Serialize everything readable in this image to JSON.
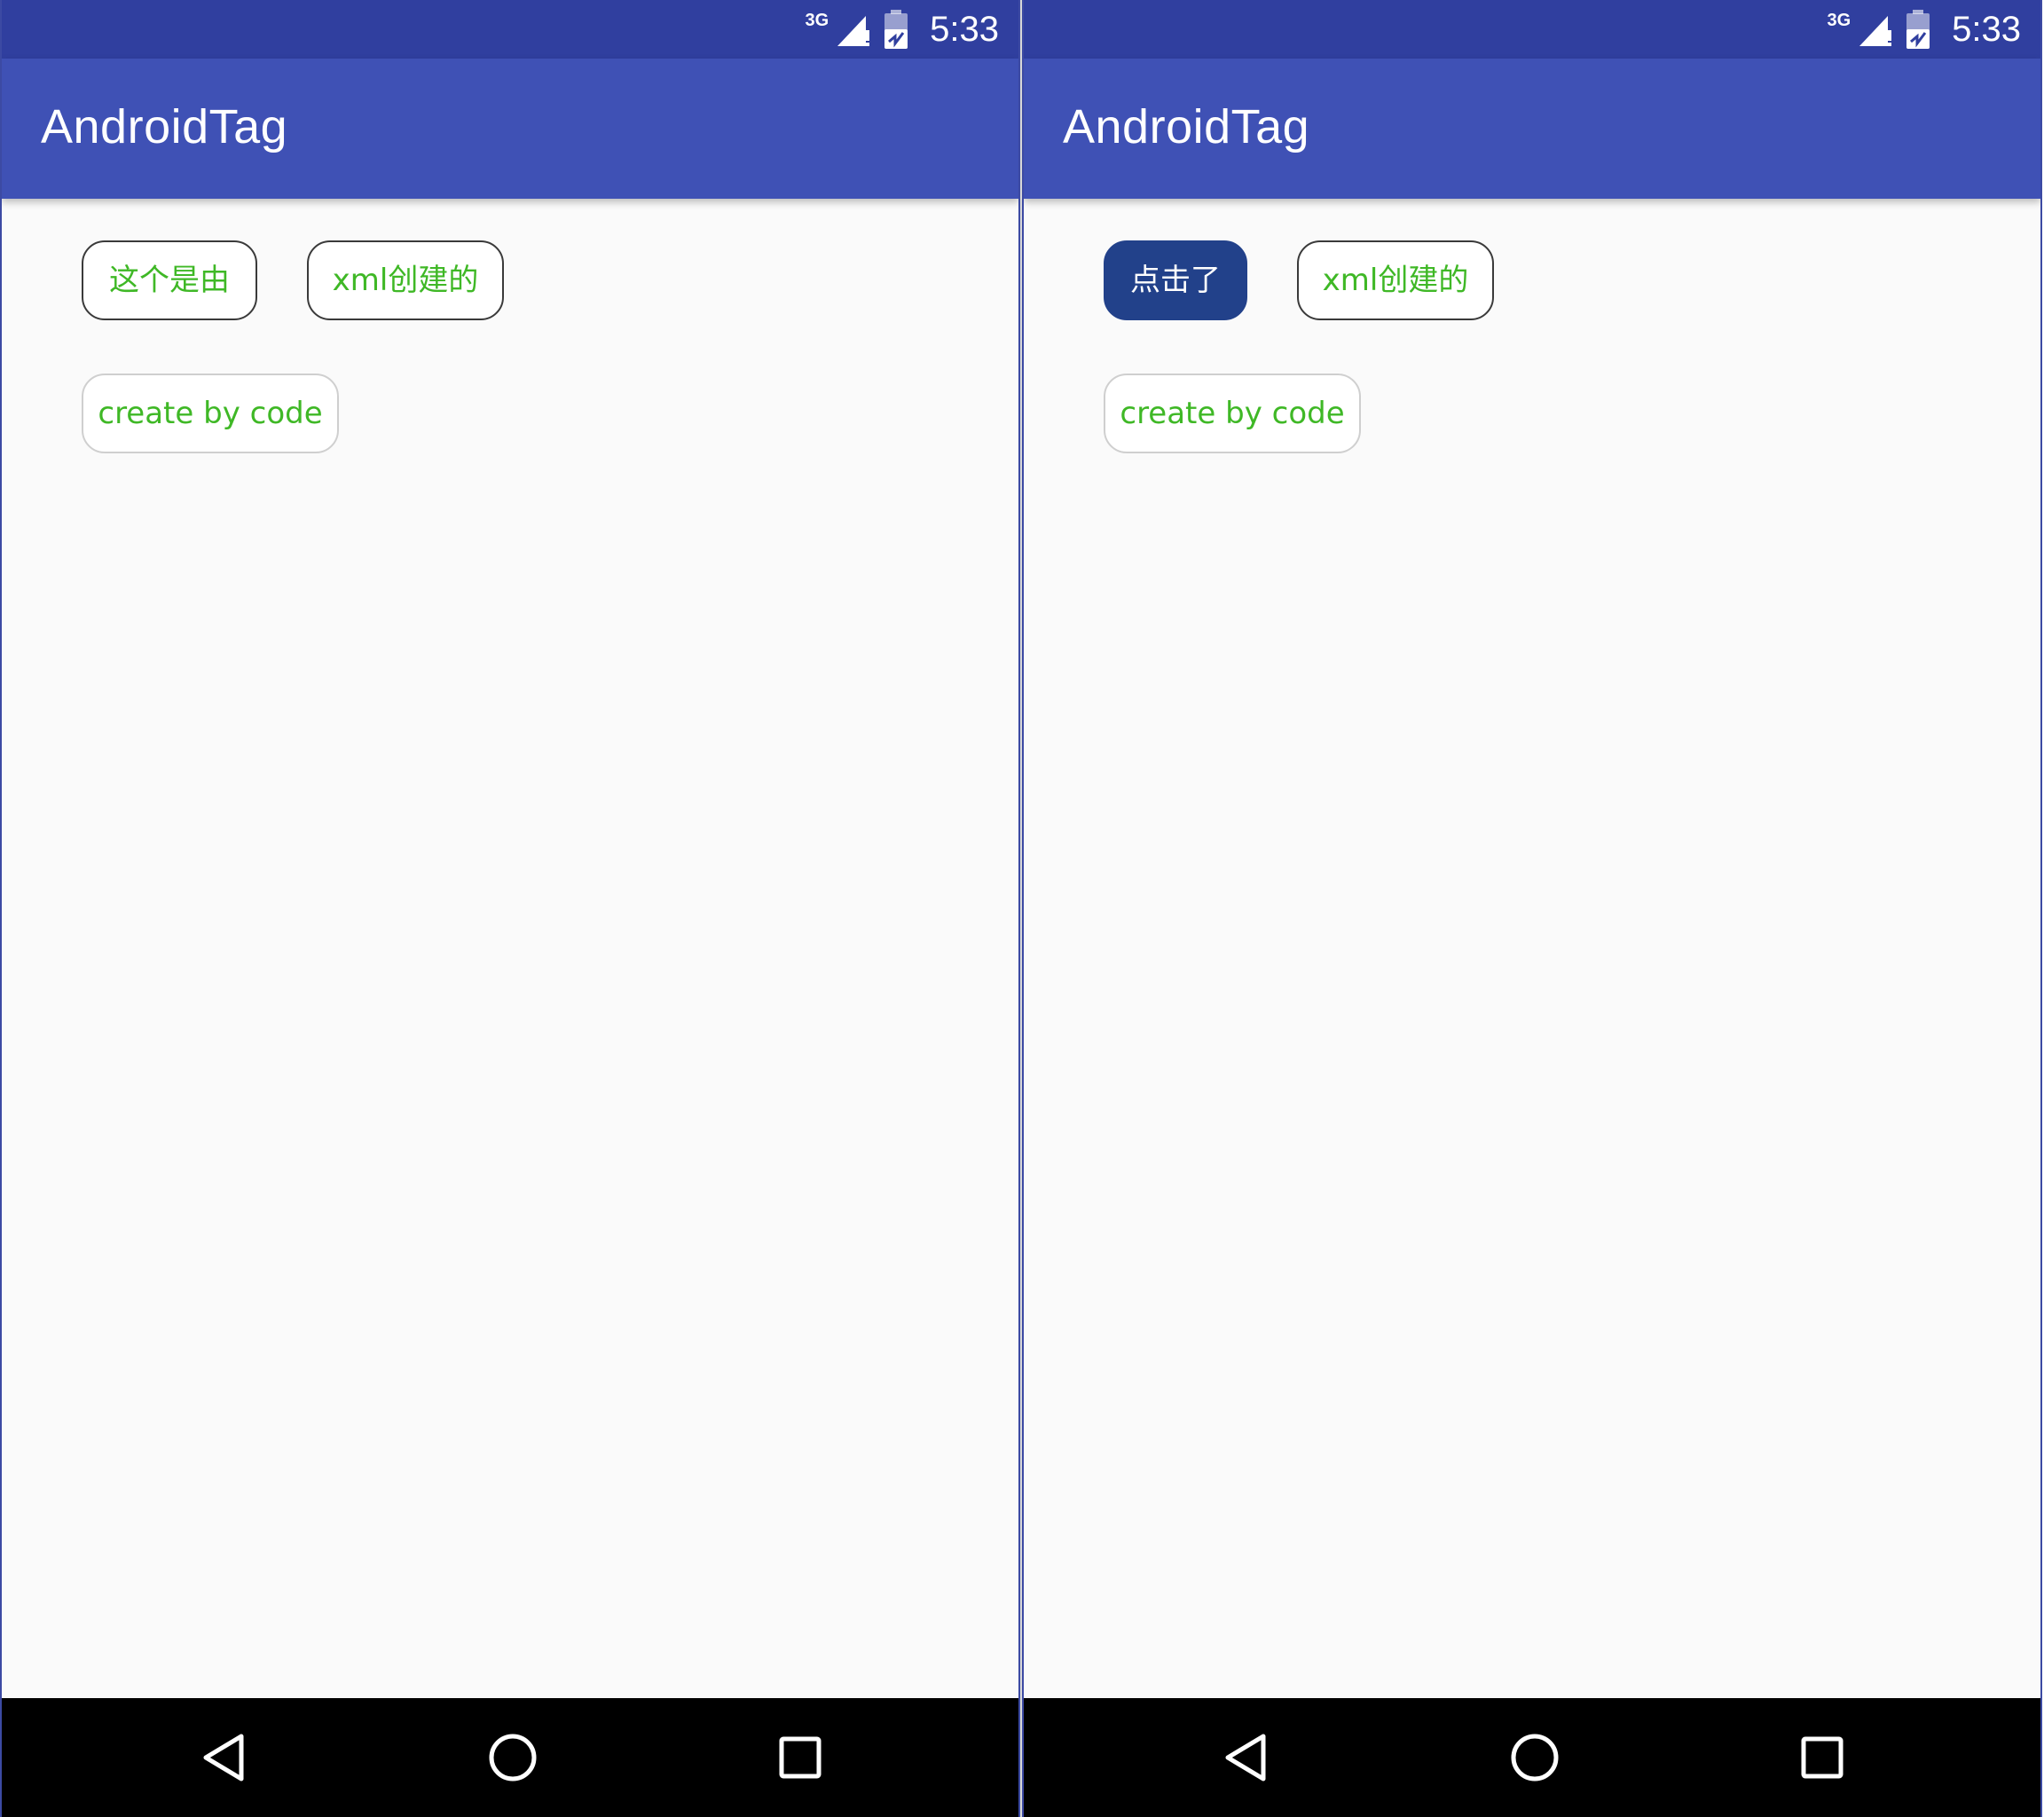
{
  "status_bar": {
    "network": "3G",
    "time": "5:33"
  },
  "app": {
    "title": "AndroidTag"
  },
  "screens": [
    {
      "tags_row1": [
        "这个是由",
        "xml创建的"
      ],
      "tags_row2": [
        "create by code"
      ]
    },
    {
      "tags_row1": [
        "点击了",
        "xml创建的"
      ],
      "tags_row2": [
        "create by code"
      ]
    }
  ],
  "colors": {
    "status_bar": "#303f9f",
    "app_bar": "#3f51b5",
    "tag_text": "#3fb826",
    "selected_tag": "#22418a",
    "background": "#fafafa"
  },
  "icons": {
    "nav": [
      "back-icon",
      "home-icon",
      "recents-icon"
    ],
    "status": [
      "signal-icon",
      "battery-icon"
    ]
  }
}
